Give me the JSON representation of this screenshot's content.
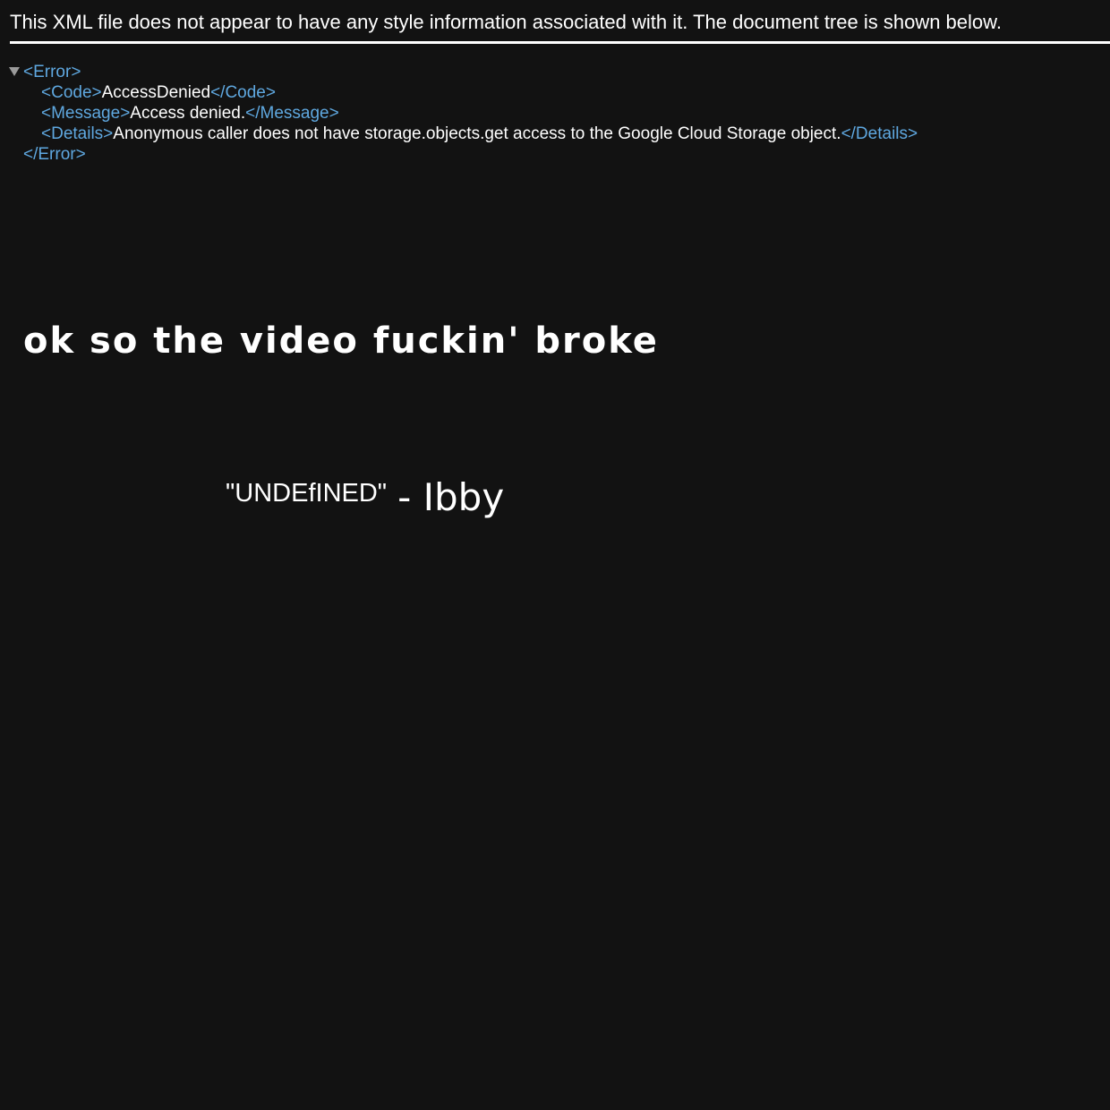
{
  "header": {
    "notice": "This XML file does not appear to have any style information associated with it. The document tree is shown below."
  },
  "xml_tree": {
    "root_open": "<Error>",
    "root_close": "</Error>",
    "code": {
      "open": "<Code>",
      "value": "AccessDenied",
      "close": "</Code>"
    },
    "message": {
      "open": "<Message>",
      "value": "Access denied.",
      "close": "</Message>"
    },
    "details": {
      "open": "<Details>",
      "value": "Anonymous caller does not have storage.objects.get access to the Google Cloud Storage object.",
      "close": "</Details>"
    }
  },
  "overlay": {
    "handwritten": "ok so the video fuckin' broke",
    "quote": "\"UNDEfINED\"",
    "attribution": "- Ibby"
  },
  "colors": {
    "background": "#121212",
    "tag": "#5fa8e0",
    "text": "#ffffff"
  }
}
